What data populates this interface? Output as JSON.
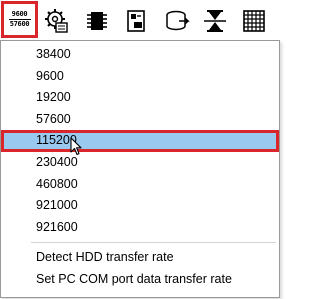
{
  "toolbar": {
    "baud_icon_top": "9600",
    "baud_icon_bottom": "57600",
    "icons": [
      "baud-rate-icon",
      "gear-settings-icon",
      "chip-icon",
      "disk-board-icon",
      "drive-icon",
      "hourglass-icon",
      "grid-icon"
    ]
  },
  "menu": {
    "items": [
      {
        "label": "38400"
      },
      {
        "label": "9600"
      },
      {
        "label": "19200"
      },
      {
        "label": "57600"
      },
      {
        "label": "115200"
      },
      {
        "label": "230400"
      },
      {
        "label": "460800"
      },
      {
        "label": "921000"
      },
      {
        "label": "921600"
      }
    ],
    "actions": [
      {
        "label": "Detect HDD transfer rate"
      },
      {
        "label": "Set PC COM port data transfer rate"
      }
    ],
    "selected_index": 4
  },
  "colors": {
    "highlight": "#99c9ef",
    "outline": "#d9262b"
  }
}
